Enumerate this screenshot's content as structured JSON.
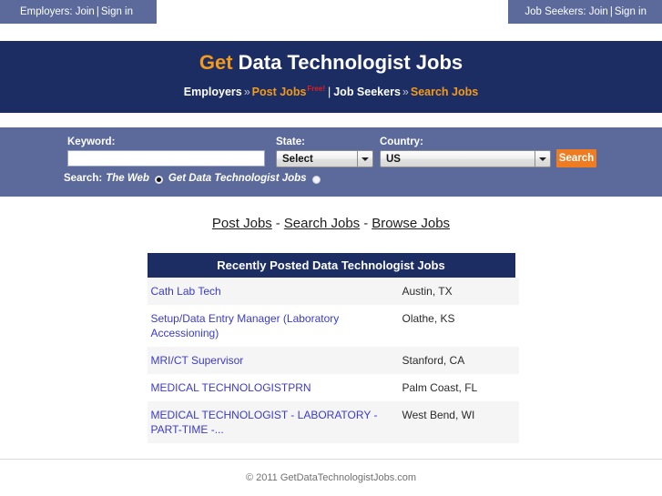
{
  "topbar": {
    "employers": {
      "prefix": "Employers:",
      "join": "Join",
      "separator": "|",
      "signin": "Sign in"
    },
    "jobseekers": {
      "prefix": "Job Seekers:",
      "join": "Join",
      "separator": "|",
      "signin": "Sign in"
    }
  },
  "masthead": {
    "title_accent": "Get",
    "title_rest": " Data Technologist Jobs",
    "tagline": {
      "employers": "Employers",
      "chevron1": "»",
      "post_jobs": "Post Jobs",
      "free_badge": "Free!",
      "divider": "|",
      "job_seekers": "Job Seekers",
      "chevron2": "»",
      "search_jobs": "Search Jobs"
    }
  },
  "search": {
    "keyword_label": "Keyword:",
    "keyword_value": "",
    "keyword_placeholder": "",
    "state_label": "State:",
    "state_value": "Select",
    "country_label": "Country:",
    "country_value": "US",
    "search_button": "Search",
    "scope_prefix": "Search:",
    "scope_option_web": "The Web",
    "scope_option_site": "Get Data Technologist Jobs",
    "scope_selected": "Get Data Technologist Jobs"
  },
  "nav": {
    "post_jobs": "Post Jobs",
    "dash1": "-",
    "search_jobs": "Search Jobs",
    "dash2": "-",
    "browse_jobs": "Browse Jobs"
  },
  "jobs": {
    "header": "Recently Posted Data Technologist Jobs",
    "rows": [
      {
        "title": "Cath Lab Tech",
        "location": "Austin, TX"
      },
      {
        "title": "Setup/Data Entry Manager (Laboratory Accessioning)",
        "location": "Olathe, KS"
      },
      {
        "title": "MRI/CT Supervisor",
        "location": "Stanford, CA"
      },
      {
        "title": "MEDICAL TECHNOLOGISTPRN",
        "location": "Palm Coast, FL"
      },
      {
        "title": "MEDICAL TECHNOLOGIST - LABORATORY - PART-TIME -...",
        "location": "West Bend, WI"
      }
    ]
  },
  "footer": {
    "copyright": "© 2011 GetDataTechnologistJobs.com"
  },
  "colors": {
    "navy": "#1c2d64",
    "slate": "#5b6a9a",
    "orange": "#f49a1a",
    "button_orange": "#f07c22",
    "link_blue": "#3b3bc8",
    "free_red": "#e02020"
  }
}
